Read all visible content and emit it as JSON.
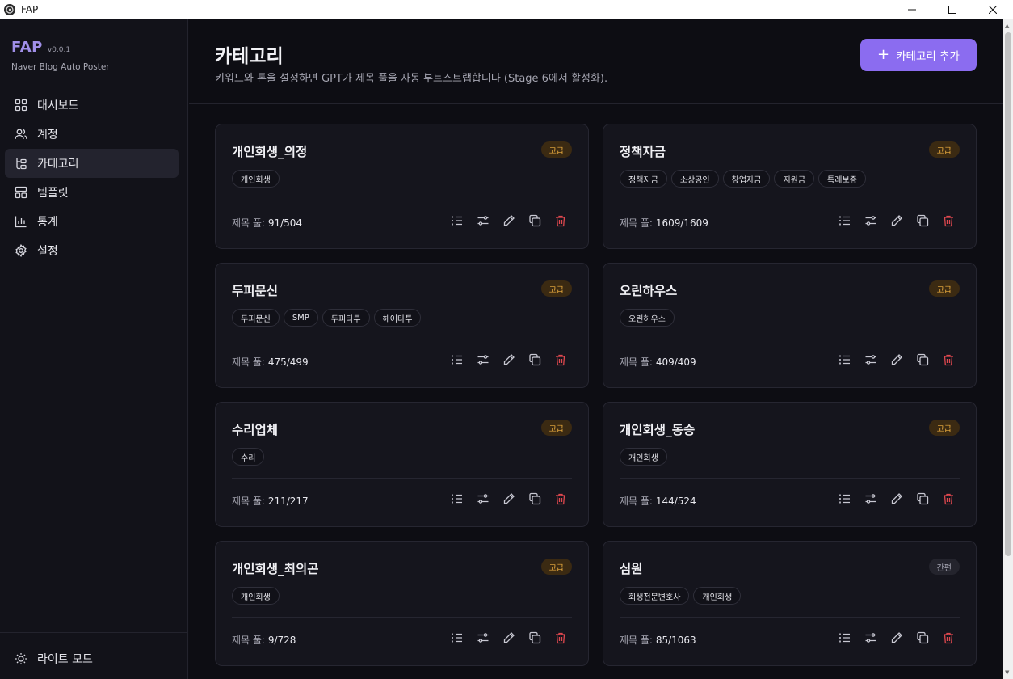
{
  "window": {
    "title": "FAP"
  },
  "brand": {
    "name": "FAP",
    "version": "v0.0.1",
    "subtitle": "Naver Blog Auto Poster"
  },
  "nav": [
    {
      "label": "대시보드",
      "icon": "dashboard-icon"
    },
    {
      "label": "계정",
      "icon": "users-icon"
    },
    {
      "label": "카테고리",
      "icon": "category-icon",
      "active": true
    },
    {
      "label": "템플릿",
      "icon": "template-icon"
    },
    {
      "label": "통계",
      "icon": "chart-icon"
    },
    {
      "label": "설정",
      "icon": "gear-icon"
    }
  ],
  "theme_toggle": {
    "label": "라이트 모드"
  },
  "header": {
    "title": "카테고리",
    "description": "키워드와 톤을 설정하면 GPT가 제목 풀을 자동 부트스트랩합니다 (Stage 6에서 활성화).",
    "add_button": "카테고리 추가"
  },
  "pool_label": "제목 풀:",
  "categories": [
    {
      "name": "개인회생_의정",
      "badge": "고급",
      "tags": [
        "개인회생"
      ],
      "pool": "91/504"
    },
    {
      "name": "정책자금",
      "badge": "고급",
      "tags": [
        "정책자금",
        "소상공인",
        "창업자금",
        "지원금",
        "특례보증"
      ],
      "pool": "1609/1609"
    },
    {
      "name": "두피문신",
      "badge": "고급",
      "tags": [
        "두피문신",
        "SMP",
        "두피타투",
        "헤어타투"
      ],
      "pool": "475/499"
    },
    {
      "name": "오린하우스",
      "badge": "고급",
      "tags": [
        "오린하우스"
      ],
      "pool": "409/409"
    },
    {
      "name": "수리업체",
      "badge": "고급",
      "tags": [
        "수리"
      ],
      "pool": "211/217"
    },
    {
      "name": "개인회생_동승",
      "badge": "고급",
      "tags": [
        "개인회생"
      ],
      "pool": "144/524"
    },
    {
      "name": "개인회생_최의곤",
      "badge": "고급",
      "tags": [
        "개인회생"
      ],
      "pool": "9/728"
    },
    {
      "name": "심원",
      "badge": "간편",
      "tags": [
        "회생전문변호사",
        "개인회생"
      ],
      "pool": "85/1063"
    }
  ],
  "colors": {
    "accent": "#8b6cf0",
    "badge_advanced": "#f0b040",
    "delete": "#e0484f"
  }
}
